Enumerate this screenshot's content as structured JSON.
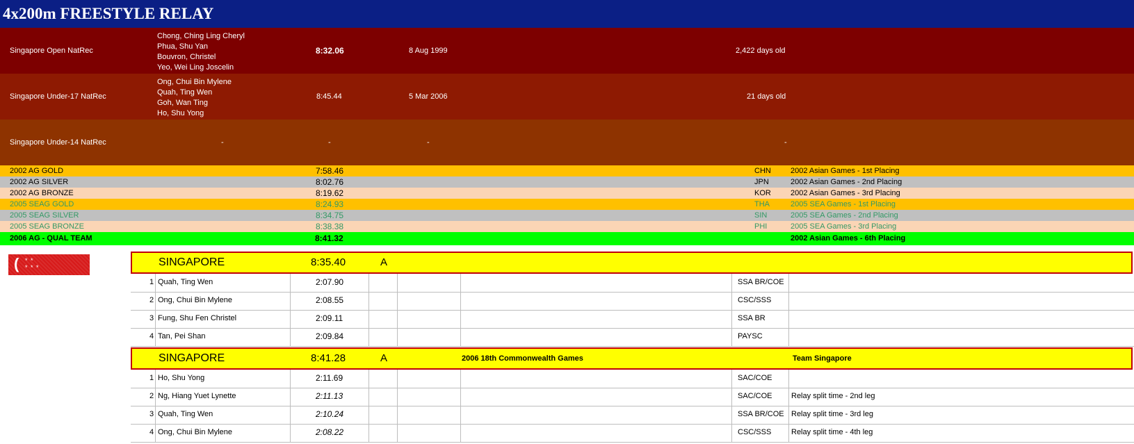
{
  "title": "4x200m FREESTYLE RELAY",
  "records": [
    {
      "label": "Singapore Open NatRec",
      "names": [
        "Chong, Ching Ling Cheryl",
        "Phua, Shu Yan",
        "Bouvron, Christel",
        "Yeo, Wei Ling Joscelin"
      ],
      "time": "8:32.06",
      "date": "8 Aug 1999",
      "age": "2,422  days old"
    },
    {
      "label": "Singapore Under-17 NatRec",
      "names": [
        "Ong, Chui Bin Mylene",
        "Quah, Ting Wen",
        "Goh, Wan Ting",
        "Ho, Shu Yong"
      ],
      "time": "8:45.44",
      "date": "5 Mar 2006",
      "age": "21  days old"
    },
    {
      "label": "Singapore Under-14 NatRec",
      "names": [
        "-"
      ],
      "time": "-",
      "date": "-",
      "age": "-"
    }
  ],
  "benchmarks": [
    {
      "label": "2002 AG GOLD",
      "time": "7:58.46",
      "country": "CHN",
      "event": "2002 Asian Games - 1st Placing",
      "bg": "#ffc000",
      "color": "#000000"
    },
    {
      "label": "2002 AG SILVER",
      "time": "8:02.76",
      "country": "JPN",
      "event": "2002 Asian Games - 2nd Placing",
      "bg": "#c0c0c0",
      "color": "#000000"
    },
    {
      "label": "2002 AG BRONZE",
      "time": "8:19.62",
      "country": "KOR",
      "event": "2002 Asian Games - 3rd Placing",
      "bg": "#fbd5b5",
      "color": "#000000"
    },
    {
      "label": "2005 SEAG GOLD",
      "time": "8:24.93",
      "country": "THA",
      "event": "2005 SEA Games - 1st Placing",
      "bg": "#ffc000",
      "color": "#339966"
    },
    {
      "label": "2005 SEAG SILVER",
      "time": "8:34.75",
      "country": "SIN",
      "event": "2005 SEA Games - 2nd Placing",
      "bg": "#c0c0c0",
      "color": "#339966"
    },
    {
      "label": "2005 SEAG BRONZE",
      "time": "8:38.38",
      "country": "PHI",
      "event": "2005 SEA Games - 3rd Placing",
      "bg": "#fbd5b5",
      "color": "#339966"
    }
  ],
  "qual": {
    "label": "2006 AG - QUAL TEAM",
    "time": "8:41.32",
    "event": "2002 Asian Games - 6th Placing"
  },
  "teams": [
    {
      "name": "SINGAPORE",
      "time": "8:35.40",
      "grade": "A",
      "meet": "",
      "team": "",
      "swimmers": [
        {
          "n": "1",
          "name": "Quah, Ting Wen",
          "split": "2:07.90",
          "club": "SSA BR/COE",
          "note": ""
        },
        {
          "n": "2",
          "name": "Ong, Chui Bin Mylene",
          "split": "2:08.55",
          "club": "CSC/SSS",
          "note": ""
        },
        {
          "n": "3",
          "name": "Fung, Shu Fen Christel",
          "split": "2:09.11",
          "club": "SSA BR",
          "note": ""
        },
        {
          "n": "4",
          "name": "Tan, Pei Shan",
          "split": "2:09.84",
          "club": "PAYSC",
          "note": ""
        }
      ]
    },
    {
      "name": "SINGAPORE",
      "time": "8:41.28",
      "grade": "A",
      "meet": "2006 18th Commonwealth Games",
      "team": "Team Singapore",
      "swimmers": [
        {
          "n": "1",
          "name": "Ho, Shu Yong",
          "split": "2:11.69",
          "club": "SAC/COE",
          "note": ""
        },
        {
          "n": "2",
          "name": "Ng, Hiang Yuet Lynette",
          "split": "2:11.13",
          "club": "SAC/COE",
          "note": "Relay split time - 2nd leg"
        },
        {
          "n": "3",
          "name": "Quah, Ting Wen",
          "split": "2:10.24",
          "club": "SSA BR/COE",
          "note": "Relay split time - 3rd leg"
        },
        {
          "n": "4",
          "name": "Ong, Chui Bin Mylene",
          "split": "2:08.22",
          "club": "CSC/SSS",
          "note": "Relay split time - 4th leg"
        }
      ]
    }
  ]
}
